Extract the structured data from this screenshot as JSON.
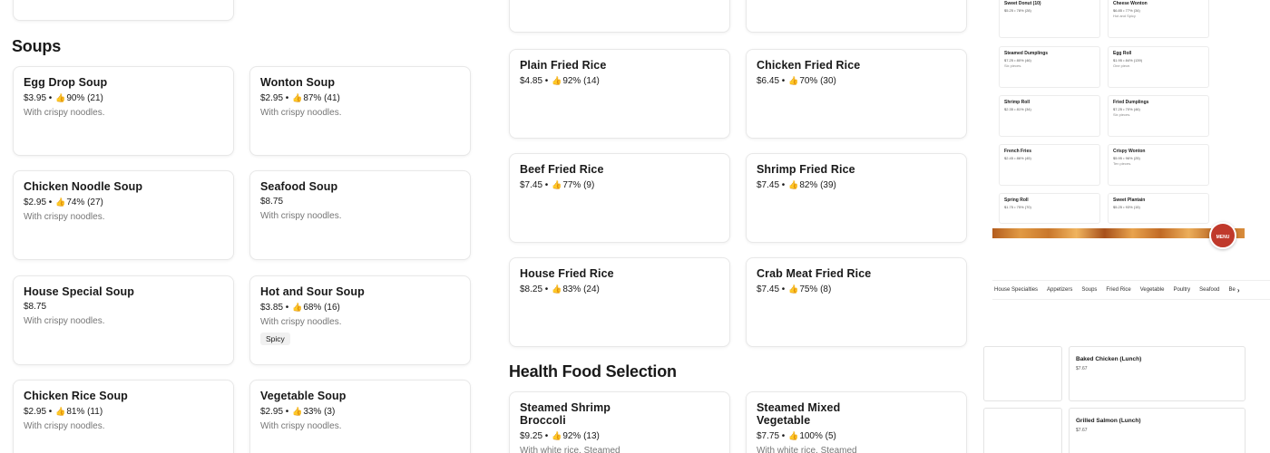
{
  "soups": {
    "heading": "Soups",
    "items": [
      {
        "name": "Egg Drop Soup",
        "price": "$3.95",
        "rating": "90% (21)",
        "desc": "With crispy noodles."
      },
      {
        "name": "Wonton Soup",
        "price": "$2.95",
        "rating": "87% (41)",
        "desc": "With crispy noodles."
      },
      {
        "name": "Chicken Noodle Soup",
        "price": "$2.95",
        "rating": "74% (27)",
        "desc": "With crispy noodles."
      },
      {
        "name": "Seafood Soup",
        "price": "$8.75",
        "rating": "",
        "desc": "With crispy noodles."
      },
      {
        "name": "House Special Soup",
        "price": "$8.75",
        "rating": "",
        "desc": "With crispy noodles."
      },
      {
        "name": "Hot and Sour Soup",
        "price": "$3.85",
        "rating": "68% (16)",
        "desc": "With crispy noodles.",
        "tag": "Spicy"
      },
      {
        "name": "Chicken Rice Soup",
        "price": "$2.95",
        "rating": "81% (11)",
        "desc": "With crispy noodles."
      },
      {
        "name": "Vegetable Soup",
        "price": "$2.95",
        "rating": "33% (3)",
        "desc": "With crispy noodles."
      }
    ]
  },
  "fried_rice": {
    "items": [
      {
        "name": "Plain Fried Rice",
        "price": "$4.85",
        "rating": "92% (14)"
      },
      {
        "name": "Chicken Fried Rice",
        "price": "$6.45",
        "rating": "70% (30)"
      },
      {
        "name": "Beef Fried Rice",
        "price": "$7.45",
        "rating": "77% (9)"
      },
      {
        "name": "Shrimp Fried Rice",
        "price": "$7.45",
        "rating": "82% (39)"
      },
      {
        "name": "House Fried Rice",
        "price": "$8.25",
        "rating": "83% (24)"
      },
      {
        "name": "Crab Meat Fried Rice",
        "price": "$7.45",
        "rating": "75% (8)"
      }
    ]
  },
  "health": {
    "heading": "Health Food Selection",
    "items": [
      {
        "name": "Steamed Shrimp Broccoli",
        "price": "$9.25",
        "rating": "92% (13)",
        "desc": "With white rice. Steamed"
      },
      {
        "name": "Steamed Mixed Vegetable",
        "price": "$7.75",
        "rating": "100% (5)",
        "desc": "With white rice. Steamed"
      }
    ]
  },
  "preview": {
    "cards": [
      {
        "name": "Sweet Donut (10)",
        "meta": "$5.25 • 78% (28)",
        "desc": ""
      },
      {
        "name": "Cheese Wonton",
        "meta": "$6.85 • 77% (34)",
        "desc": "Hot and Spicy"
      },
      {
        "name": "Steamed Dumplings",
        "meta": "$7.25 • 80% (46)",
        "desc": "Six pieces."
      },
      {
        "name": "Egg Roll",
        "meta": "$1.95 • 84% (139)",
        "desc": "One piece."
      },
      {
        "name": "Shrimp Roll",
        "meta": "$2.35 • 81% (34)",
        "desc": ""
      },
      {
        "name": "Fried Dumplings",
        "meta": "$7.25 • 70% (46)",
        "desc": "Six pieces."
      },
      {
        "name": "French Fries",
        "meta": "$2.45 • 86% (45)",
        "desc": ""
      },
      {
        "name": "Crispy Wonton",
        "meta": "$5.95 • 96% (25)",
        "desc": "Ten pieces."
      },
      {
        "name": "Spring Roll",
        "meta": "$1.75 • 75% (70)",
        "desc": ""
      },
      {
        "name": "Sweet Plantain",
        "meta": "$5.25 • 93% (15)",
        "desc": ""
      }
    ],
    "logo_text": "MENU",
    "tabs": [
      "House Specialties",
      "Appetizers",
      "Soups",
      "Fried Rice",
      "Vegetable",
      "Poultry",
      "Seafood",
      "Be"
    ],
    "lunch": [
      {
        "name": "Baked Chicken (Lunch)",
        "price": "$7.67"
      },
      {
        "name": "Grilled Salmon (Lunch)",
        "price": "$7.67"
      }
    ]
  },
  "icons": {
    "thumb": "thumbs-up-icon",
    "chevron": "chevron-right-icon"
  },
  "colors": {
    "text": "#191919",
    "muted": "#767676",
    "border": "#e8e8e8"
  }
}
